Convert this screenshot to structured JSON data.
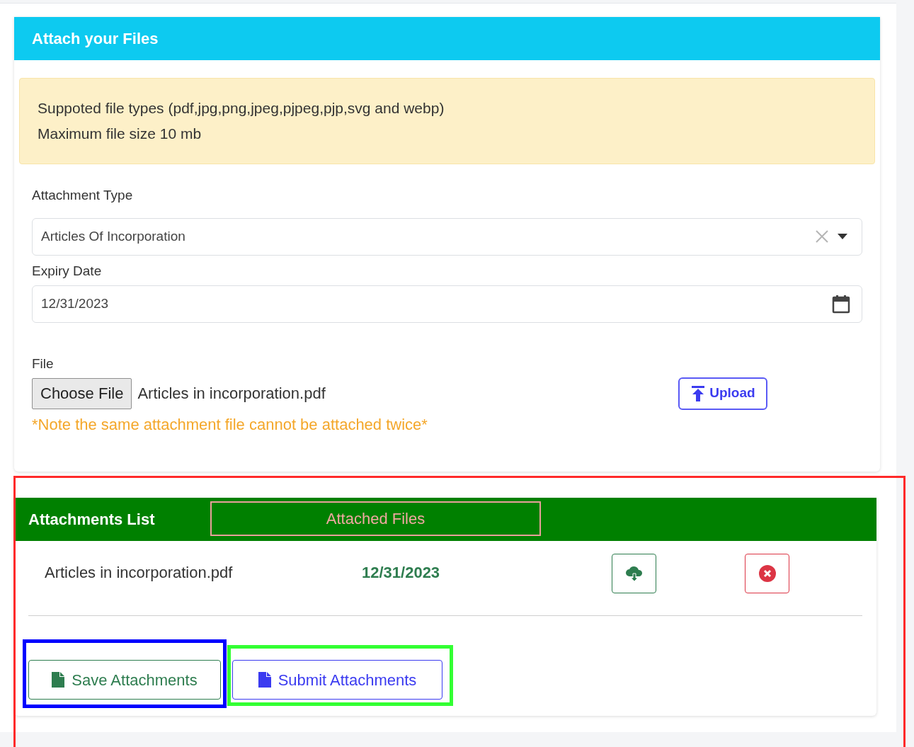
{
  "upload_card": {
    "title": "Attach your Files",
    "notice": [
      "Suppoted file types (pdf,jpg,png,jpeg,pjpeg,pjp,svg and webp)",
      "Maximum file size 10 mb"
    ],
    "attachment_type": {
      "label": "Attachment Type",
      "value": "Articles Of Incorporation"
    },
    "expiry_date": {
      "label": "Expiry Date",
      "value": "12/31/2023"
    },
    "file": {
      "label": "File",
      "button": "Choose File",
      "value": "Articles in incorporation.pdf"
    },
    "upload_button": "Upload",
    "note": "*Note the same attachment file cannot be attached twice*"
  },
  "attachments_card": {
    "title": "Attachments List",
    "rows": [
      {
        "file": "Articles in incorporation.pdf",
        "date": "12/31/2023"
      }
    ],
    "buttons": [
      {
        "label": "Save Attachments",
        "kind": "save"
      },
      {
        "label": "Submit Attachments",
        "kind": "submit"
      }
    ]
  },
  "annotations": [
    {
      "color": "#ff2a2a"
    },
    {
      "color": "#e8a09a",
      "label": "Attached Files"
    },
    {
      "color": "#0000ff"
    },
    {
      "color": "#33ff33"
    }
  ]
}
